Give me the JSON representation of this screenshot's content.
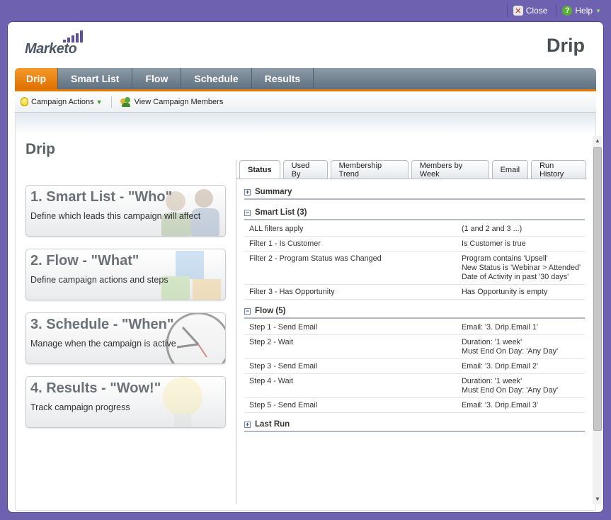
{
  "topbar": {
    "close_label": "Close",
    "help_label": "Help"
  },
  "brand": {
    "logo_text": "Marketo",
    "page_heading": "Drip"
  },
  "tabs": [
    {
      "label": "Drip",
      "active": true
    },
    {
      "label": "Smart List"
    },
    {
      "label": "Flow"
    },
    {
      "label": "Schedule"
    },
    {
      "label": "Results"
    }
  ],
  "toolbar": {
    "campaign_actions": "Campaign Actions",
    "view_members": "View Campaign Members"
  },
  "main": {
    "title": "Drip",
    "cards": [
      {
        "title": "1. Smart List - \"Who\"",
        "desc": "Define which leads this campaign will affect"
      },
      {
        "title": "2. Flow - \"What\"",
        "desc": "Define campaign actions and steps"
      },
      {
        "title": "3. Schedule - \"When\"",
        "desc": "Manage when the campaign is active"
      },
      {
        "title": "4. Results - \"Wow!\"",
        "desc": "Track campaign progress"
      }
    ]
  },
  "panel": {
    "tabs": [
      "Status",
      "Used By",
      "Membership Trend",
      "Members by Week",
      "Email",
      "Run History"
    ],
    "summary": "Summary",
    "smart_list": {
      "header": "Smart List (3)",
      "rows": [
        {
          "c1": "ALL filters apply",
          "c2": [
            "(1 and 2 and 3 ...)"
          ]
        },
        {
          "c1": "Filter 1 - Is Customer",
          "c2": [
            "Is Customer is true"
          ]
        },
        {
          "c1": "Filter 2 - Program Status was Changed",
          "c2": [
            "Program contains 'Upsell'",
            "New Status is 'Webinar > Attended'",
            "Date of Activity in past '30 days'"
          ]
        },
        {
          "c1": "Filter 3 - Has Opportunity",
          "c2": [
            "Has Opportunity is empty"
          ]
        }
      ]
    },
    "flow": {
      "header": "Flow (5)",
      "rows": [
        {
          "c1": "Step 1 - Send Email",
          "c2": [
            "Email: '3. Drip.Email 1'"
          ]
        },
        {
          "c1": "Step 2 - Wait",
          "c2": [
            "Duration: '1 week'",
            "Must End On Day: 'Any Day'"
          ]
        },
        {
          "c1": "Step 3 - Send Email",
          "c2": [
            "Email: '3. Drip.Email 2'"
          ]
        },
        {
          "c1": "Step 4 - Wait",
          "c2": [
            "Duration: '1 week'",
            "Must End On Day: 'Any Day'"
          ]
        },
        {
          "c1": "Step 5 - Send Email",
          "c2": [
            "Email: '3. Drip.Email 3'"
          ]
        }
      ]
    },
    "last_run": "Last Run"
  },
  "colors": {
    "background": "#6e62b0",
    "accent": "#e67a00",
    "tabbar": "#6e7e8b"
  }
}
